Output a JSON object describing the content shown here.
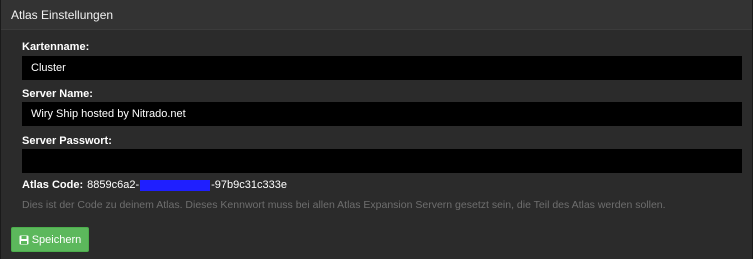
{
  "header": {
    "title": "Atlas Einstellungen"
  },
  "fields": {
    "map_name": {
      "label": "Kartenname:",
      "value": "Cluster"
    },
    "server_name": {
      "label": "Server Name:",
      "value": "Wiry Ship hosted by Nitrado.net"
    },
    "server_password": {
      "label": "Server Passwort:",
      "value": ""
    }
  },
  "atlas_code": {
    "label": "Atlas Code:",
    "prefix": "8859c6a2-",
    "suffix": "-97b9c31c333e",
    "redaction_color": "#1f1fff"
  },
  "hint": "Dies ist der Code zu deinem Atlas. Dieses Kennwort muss bei allen Atlas Expansion Servern gesetzt sein, die Teil des Atlas werden sollen.",
  "save_button": {
    "label": "Speichern",
    "icon": "save-icon",
    "color": "#5cb85c"
  }
}
